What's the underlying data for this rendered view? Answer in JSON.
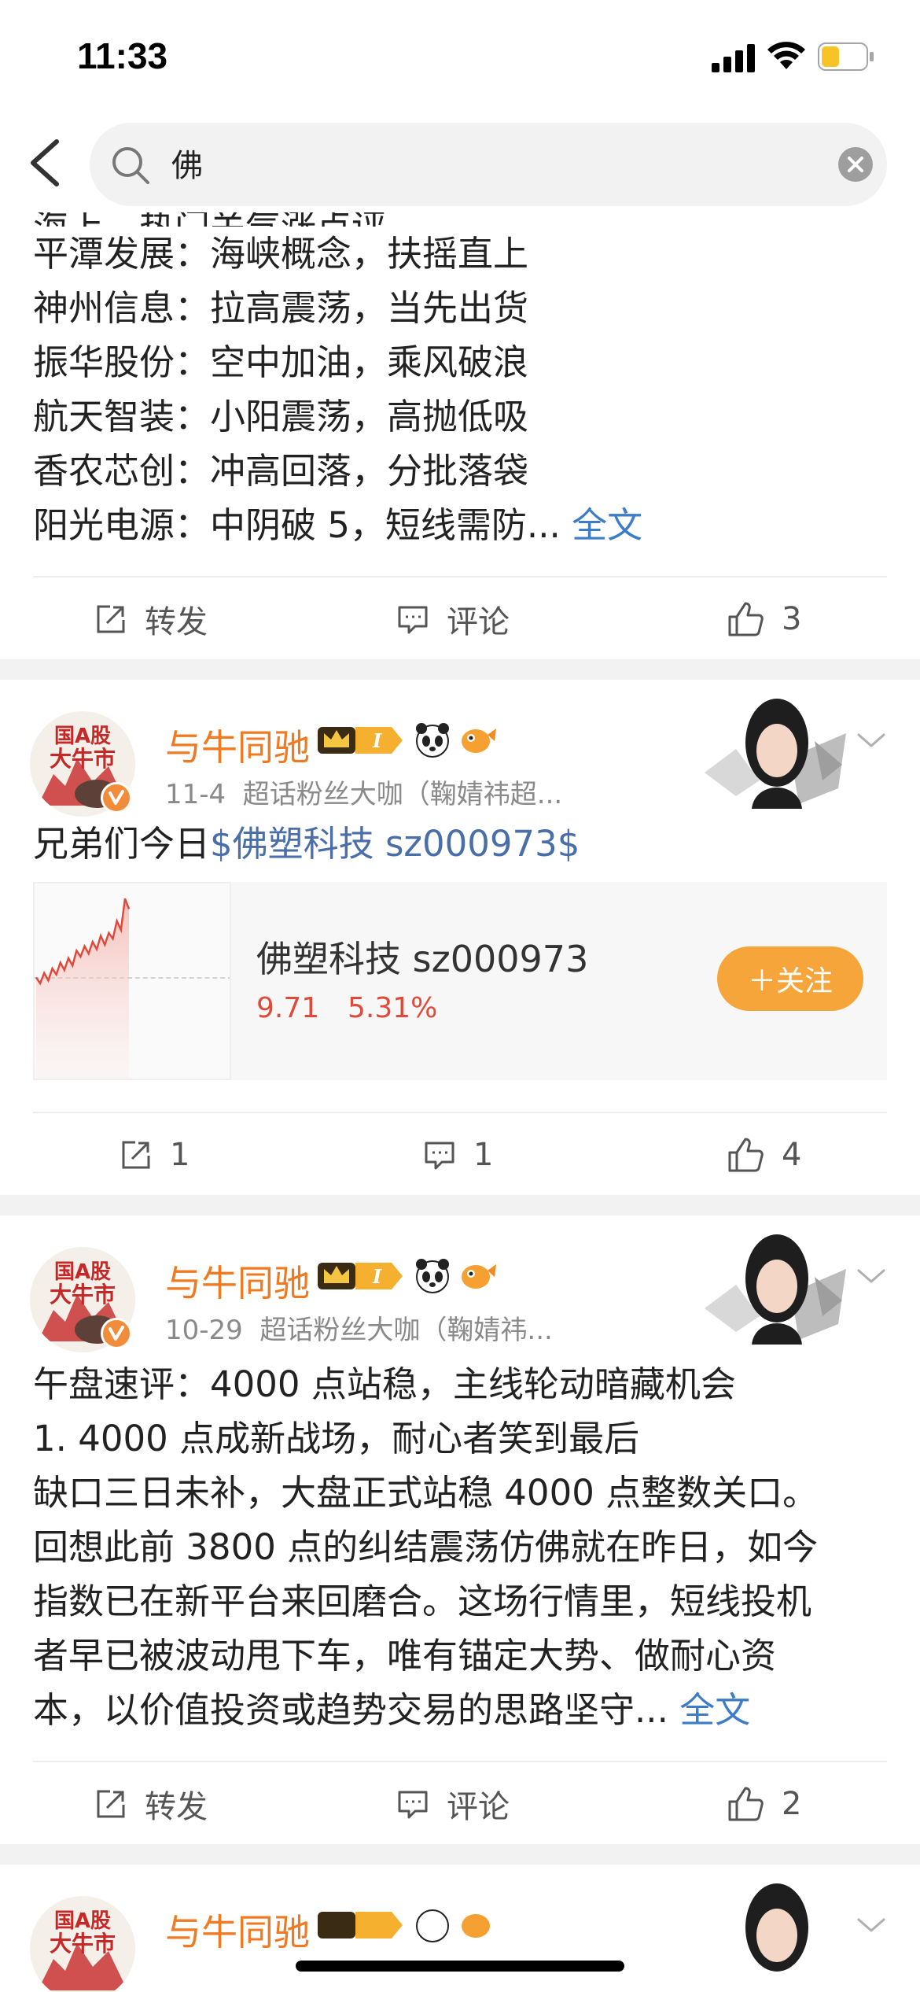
{
  "status_bar": {
    "time": "11:33",
    "battery_level": 0.4,
    "battery_color": "#f7c325"
  },
  "search": {
    "query": "佛",
    "icon": "search-icon"
  },
  "posts": [
    {
      "lines": [
        "海上，热门关气涨点评",
        "平潭发展：海峡概念，扶摇直上",
        "神州信息：拉高震荡，当先出货",
        "振华股份：空中加油，乘风破浪",
        "航天智装：小阳震荡，高抛低吸",
        "香农芯创：冲高回落，分批落袋",
        "阳光电源：中阴破 5，短线需防..."
      ],
      "full_text_link": "全文",
      "repost": "转发",
      "comment": "评论",
      "likes": "3"
    },
    {
      "user": "与牛同驰",
      "date": "11-4",
      "meta": "超话粉丝大咖（鞠婧祎超...",
      "text_prefix": "兄弟们今日",
      "stock_link": "$佛塑科技 sz000973$",
      "stock": {
        "name": "佛塑科技 sz000973",
        "price": "9.71",
        "change": "5.31%",
        "follow": "＋关注"
      },
      "repost": "1",
      "comment": "1",
      "likes": "4"
    },
    {
      "user": "与牛同驰",
      "date": "10-29",
      "meta": "超话粉丝大咖（鞠婧祎...",
      "lines": [
        "午盘速评：4000 点站稳，主线轮动暗藏机会",
        "1. 4000 点成新战场，耐心者笑到最后",
        "缺口三日未补，大盘正式站稳 4000 点整数关口。",
        "回想此前 3800 点的纠结震荡仿佛就在昨日，如今",
        "指数已在新平台来回磨合。这场行情里，短线投机",
        "者早已被波动甩下车，唯有锚定大势、做耐心资",
        "本，以价值投资或趋势交易的思路坚守..."
      ],
      "full_text_link": "全文",
      "repost": "转发",
      "comment": "评论",
      "likes": "2"
    },
    {
      "user": "与牛同驰"
    }
  ],
  "avatar_text": "国A股大牛市",
  "colors": {
    "accent": "#f07a22",
    "link": "#4a6ea8",
    "stock_up": "#e04a3a",
    "follow_btn": "#f5a53a"
  }
}
